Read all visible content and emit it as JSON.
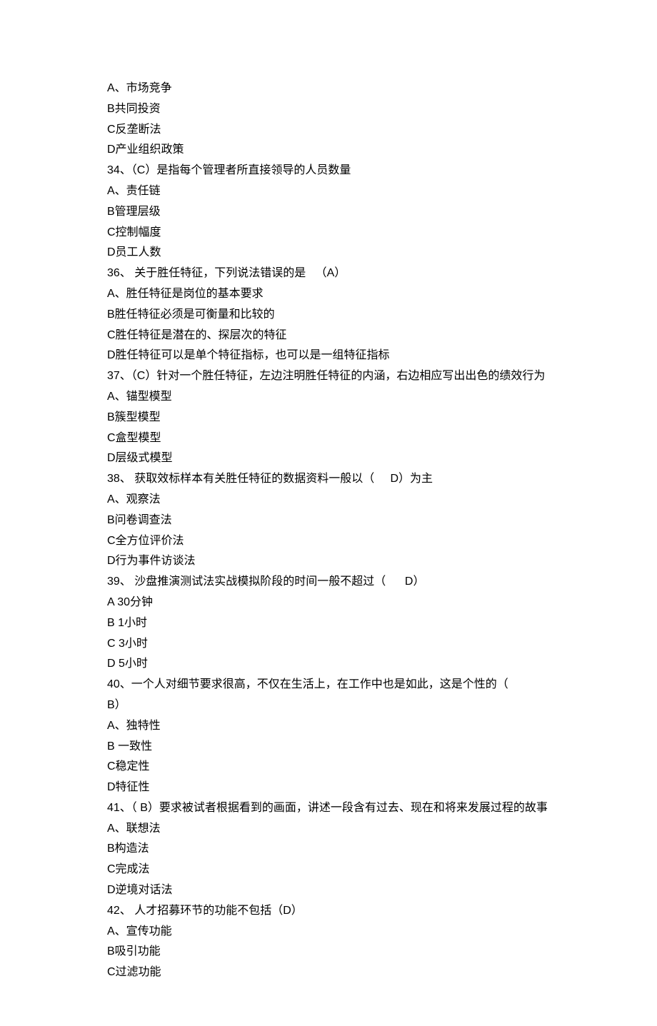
{
  "lines": [
    "A、市场竞争",
    "B共同投资",
    "C反垄断法",
    "D产业组织政策",
    "34、（C）是指每个管理者所直接领导的人员数量",
    "A、责任链",
    "B管理层级",
    "C控制幅度",
    "D员工人数",
    "36、 关于胜任特征，下列说法错误的是   （A）",
    "A、胜任特征是岗位的基本要求",
    "B胜任特征必须是可衡量和比较的",
    "C胜任特征是潜在的、探层次的特征",
    "D胜任特征可以是单个特征指标，也可以是一组特征指标",
    "37、（C）针对一个胜任特征，左边注明胜任特征的内涵，右边相应写出出色的绩效行为",
    "A、锚型模型",
    "B簇型模型",
    "C盒型模型",
    "D层级式模型",
    "38、 获取效标样本有关胜任特征的数据资料一般以（     D）为主",
    "A、观察法",
    "B问卷调查法",
    "C全方位评价法",
    "D行为事件访谈法",
    "39、 沙盘推演测试法实战模拟阶段的时间一般不超过（      D）",
    "A 30分钟",
    "B 1小时",
    "C 3小时",
    "D 5小时",
    "40、一个人对细节要求很高，不仅在生活上，在工作中也是如此，这是个性的（         B）",
    "A、独特性",
    "B 一致性",
    "C稳定性",
    "D特征性",
    "41、（ B）要求被试者根据看到的画面，讲述一段含有过去、现在和将来发展过程的故事",
    "A、联想法",
    "B构造法",
    "C完成法",
    "D逆境对话法",
    "42、 人才招募环节的功能不包括（D）",
    "A、宣传功能",
    "B吸引功能",
    "C过滤功能"
  ]
}
